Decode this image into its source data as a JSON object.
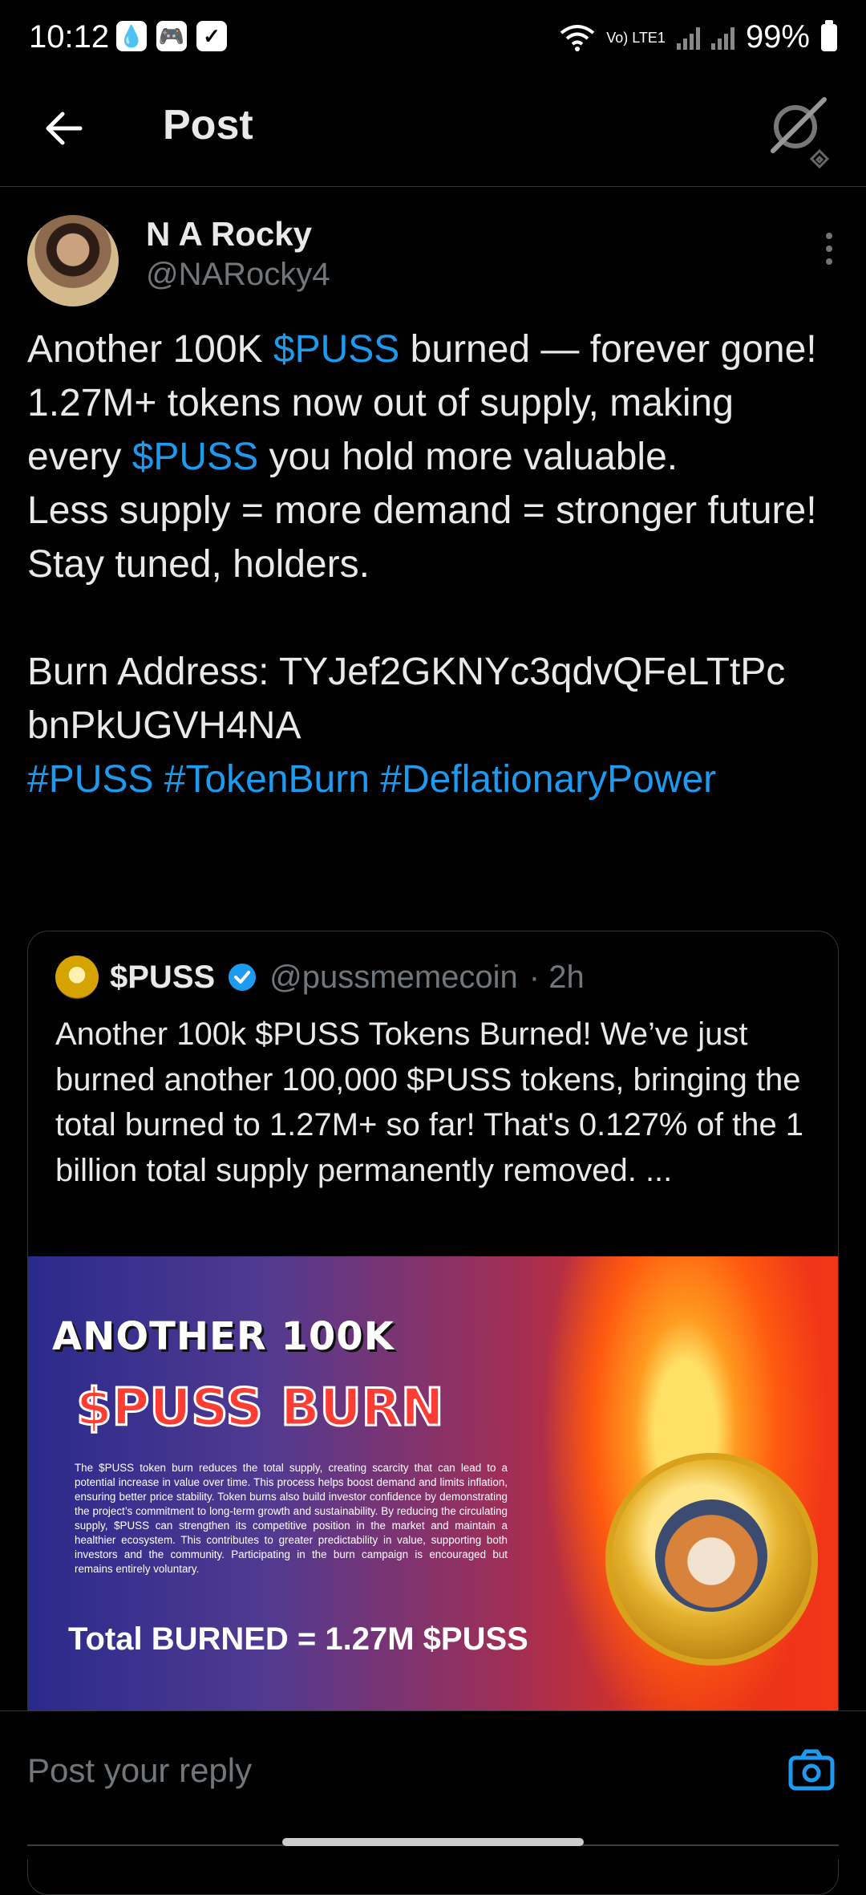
{
  "status_bar": {
    "time": "10:12",
    "icons": [
      "water-drop-icon",
      "game-controller-icon",
      "checkbox-icon"
    ],
    "network": "Vo) LTE1",
    "battery": "99%"
  },
  "header": {
    "title": "Post"
  },
  "author": {
    "name": "N A Rocky",
    "handle": "@NARocky4"
  },
  "post": {
    "line1_pre": "Another 100K ",
    "cashtag": "$PUSS",
    "line1_post": " burned — forever gone!",
    "line2": "1.27M+ tokens now out of supply, making",
    "line3_pre": "every ",
    "line3_post": " you hold more valuable.",
    "line4": "Less supply = more demand = stronger future!",
    "line5": "Stay tuned, holders.",
    "line6": "Burn Address: TYJef2GKNYc3qdvQFeLTtPc bnPkUGVH4NA",
    "hashtags": "#PUSS #TokenBurn #DeflationaryPower"
  },
  "quote": {
    "name": "$PUSS",
    "handle": "@pussmemecoin",
    "time": "· 2h",
    "text": "Another 100k $PUSS Tokens Burned! We’ve just burned another 100,000 $PUSS tokens, bringing the total burned to 1.27M+ so far! That's 0.127% of the 1 billion total supply permanently removed. ..."
  },
  "banner": {
    "title1": "ANOTHER 100K",
    "title2": "$PUSS BURN",
    "paragraph": "The $PUSS token burn reduces the total supply, creating scarcity that can lead to a potential increase in value over time. This process helps boost demand and limits inflation, ensuring better price stability. Token burns also build investor confidence by demonstrating the project’s commitment to long-term growth and sustainability. By reducing the circulating supply, $PUSS can strengthen its competitive position in the market and maintain a healthier ecosystem. This contributes to greater predictability in value, supporting both investors and the community. Participating in the burn campaign is encouraged but remains entirely voluntary.",
    "total": "Total BURNED = 1.27M $PUSS"
  },
  "reply": {
    "placeholder": "Post your reply"
  },
  "colors": {
    "accent": "#1d9bf0",
    "background": "#000000",
    "muted": "#71767b"
  }
}
